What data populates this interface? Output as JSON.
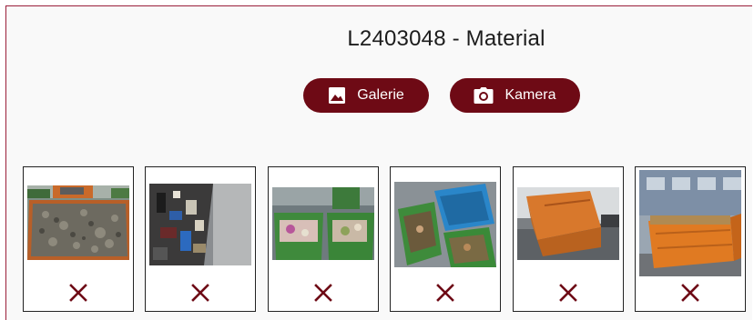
{
  "header": {
    "title": "L2403048 - Material"
  },
  "actions": {
    "galerie_label": "Galerie",
    "kamera_label": "Kamera"
  },
  "colors": {
    "accent": "#6e0a15",
    "frame": "#9a1f3a",
    "background": "#f9f9f9"
  },
  "photos": [
    {
      "subject": "container with gravel"
    },
    {
      "subject": "mixed waste pile"
    },
    {
      "subject": "green bins with trash"
    },
    {
      "subject": "green and blue bins"
    },
    {
      "subject": "orange skip on street"
    },
    {
      "subject": "orange skip full of debris"
    }
  ],
  "icons": {
    "galerie": "image-icon",
    "kamera": "camera-icon",
    "remove": "close-icon"
  }
}
